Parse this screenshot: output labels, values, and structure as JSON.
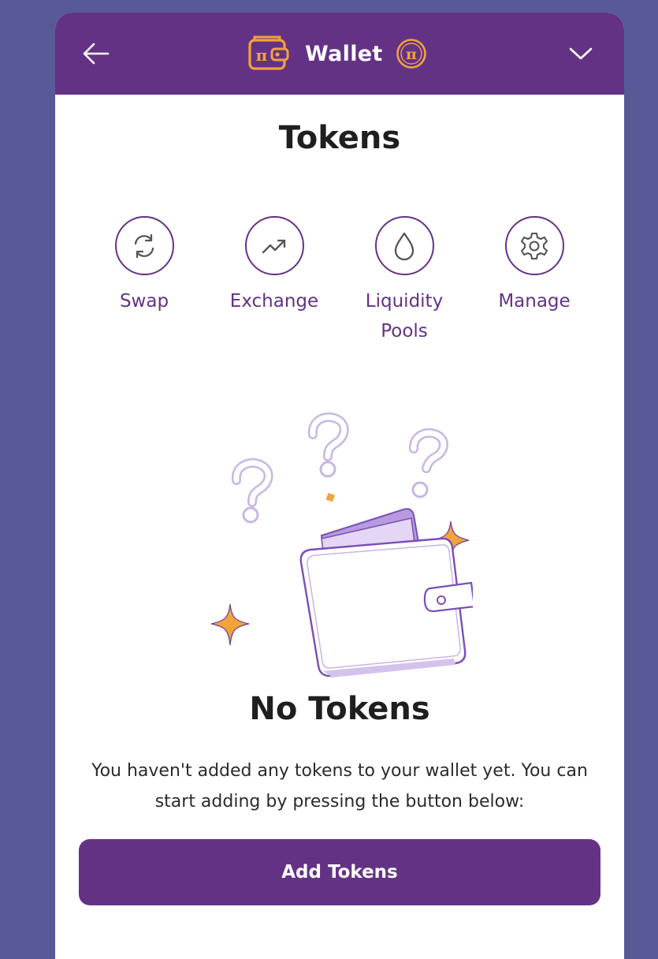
{
  "header": {
    "title": "Wallet",
    "logo_text": "π",
    "coin_text": "π"
  },
  "page_title": "Tokens",
  "actions": [
    {
      "label": "Swap",
      "icon": "swap-icon"
    },
    {
      "label": "Exchange",
      "icon": "trend-up-icon"
    },
    {
      "label": "Liquidity Pools",
      "icon": "droplet-icon"
    },
    {
      "label": "Manage",
      "icon": "gear-icon"
    }
  ],
  "empty_state": {
    "title": "No Tokens",
    "description": "You haven't added any tokens to your wallet yet. You can start adding by pressing the button below:"
  },
  "add_button_label": "Add Tokens",
  "colors": {
    "primary": "#643285",
    "background": "#585a97",
    "accent": "#f2a33a"
  }
}
